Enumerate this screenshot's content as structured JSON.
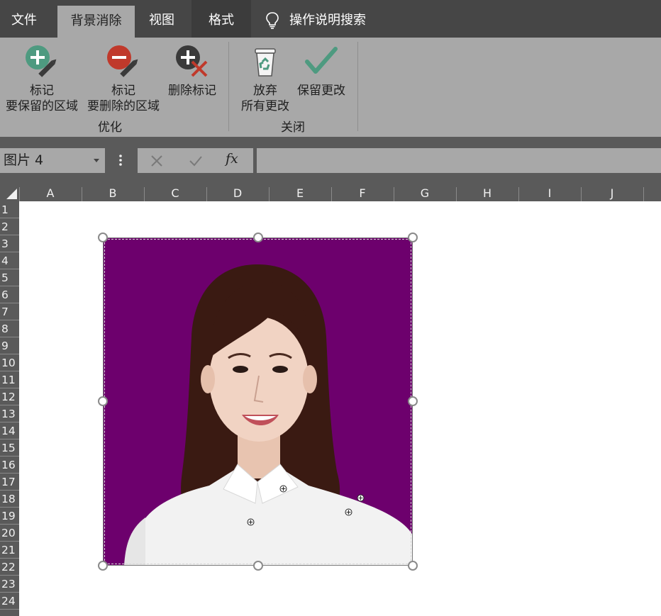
{
  "menu": {
    "tabs": [
      {
        "label": "文件",
        "active": false
      },
      {
        "label": "背景消除",
        "active": true
      },
      {
        "label": "视图",
        "active": false
      },
      {
        "label": "格式",
        "active": false
      }
    ],
    "tell_me": "操作说明搜索"
  },
  "ribbon": {
    "groups": [
      {
        "label": "优化",
        "buttons": [
          {
            "line1": "标记",
            "line2": "要保留的区域",
            "icon": "plus-pencil-icon"
          },
          {
            "line1": "标记",
            "line2": "要删除的区域",
            "icon": "minus-pencil-icon"
          },
          {
            "line1": "删除标记",
            "line2": "",
            "icon": "delete-mark-icon"
          }
        ]
      },
      {
        "label": "关闭",
        "buttons": [
          {
            "line1": "放弃",
            "line2": "所有更改",
            "icon": "recycle-bin-icon"
          },
          {
            "line1": "保留更改",
            "line2": "",
            "icon": "checkmark-icon"
          }
        ]
      }
    ]
  },
  "formula_bar": {
    "name_box": "图片 4",
    "cancel_icon": "cancel-x-icon",
    "enter_icon": "enter-check-icon",
    "fx_label": "fx",
    "value": ""
  },
  "grid": {
    "columns": [
      "A",
      "B",
      "C",
      "D",
      "E",
      "F",
      "G",
      "H",
      "I",
      "J"
    ],
    "rows": [
      "1",
      "2",
      "3",
      "4",
      "5",
      "6",
      "7",
      "8",
      "9",
      "10",
      "11",
      "12",
      "13",
      "14",
      "15",
      "16",
      "17",
      "18",
      "19",
      "20",
      "21",
      "22",
      "23",
      "24"
    ]
  },
  "picture": {
    "background_color": "#6d006d",
    "subject": "portrait-photo",
    "keep_markers": 4
  },
  "colors": {
    "title_bar": "#464646",
    "ribbon": "#a8a8a8",
    "header": "#5a5a5a",
    "keep_green": "#4e9a80",
    "remove_red": "#c0392b"
  }
}
